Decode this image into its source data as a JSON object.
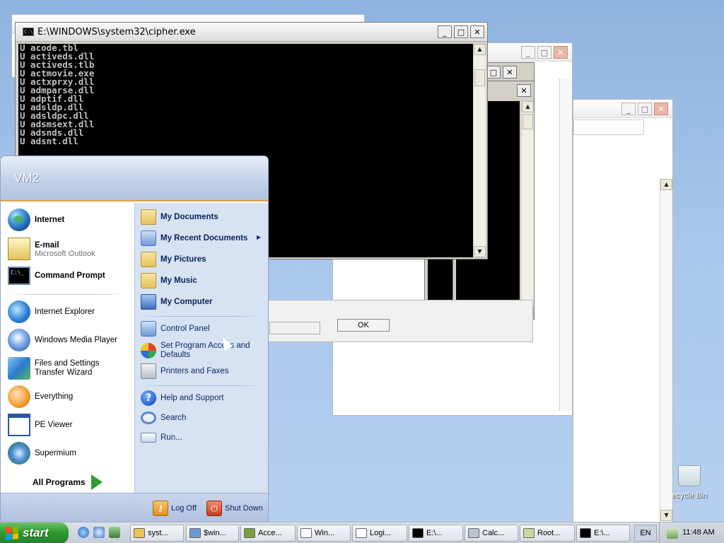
{
  "console": {
    "title": "E:\\WINDOWS\\system32\\cipher.exe",
    "lines": [
      "U acode.tbl",
      "U activeds.dll",
      "U activeds.tlb",
      "U actmovie.exe",
      "U actxprxy.dll",
      "U admparse.dll",
      "U adptif.dll",
      "U adsldp.dll",
      "U adsldpc.dll",
      "U adsmsext.dll",
      "U adsnds.dll",
      "U adsnt.dll"
    ]
  },
  "dialog": {
    "ok_label": "OK"
  },
  "start_menu": {
    "user": "VM2",
    "pinned": [
      {
        "label": "Internet"
      },
      {
        "label": "E-mail",
        "sub": "Microsoft Outlook"
      },
      {
        "label": "Command Prompt"
      }
    ],
    "recent": [
      {
        "label": "Internet Explorer"
      },
      {
        "label": "Windows Media Player"
      },
      {
        "label": "Files and Settings Transfer Wizard"
      },
      {
        "label": "Everything"
      },
      {
        "label": "PE Viewer"
      },
      {
        "label": "Supermium"
      }
    ],
    "all_programs": "All Programs",
    "places": [
      {
        "label": "My Documents"
      },
      {
        "label": "My Recent Documents"
      },
      {
        "label": "My Pictures"
      },
      {
        "label": "My Music"
      },
      {
        "label": "My Computer"
      }
    ],
    "settings": [
      {
        "label": "Control Panel"
      },
      {
        "label": "Set Program Access and Defaults"
      },
      {
        "label": "Printers and Faxes"
      }
    ],
    "tools": [
      {
        "label": "Help and Support"
      },
      {
        "label": "Search"
      },
      {
        "label": "Run..."
      }
    ],
    "log_off": "Log Off",
    "shut_down": "Shut Down"
  },
  "taskbar": {
    "start_label": "start",
    "tasks": [
      {
        "label": "syst...",
        "icon_color": "#e8c45a"
      },
      {
        "label": "$win...",
        "icon_color": "#6d98d8"
      },
      {
        "label": "Acce...",
        "icon_color": "#7a9e3a"
      },
      {
        "label": "Win...",
        "icon_color": "#ffffff"
      },
      {
        "label": "Logi...",
        "icon_color": "#ffffff"
      },
      {
        "label": "E:\\...",
        "icon_color": "#000000"
      },
      {
        "label": "Calc...",
        "icon_color": "#b9c3d3"
      },
      {
        "label": "Root...",
        "icon_color": "#cbd7a2"
      },
      {
        "label": "E:\\...",
        "icon_color": "#000000"
      }
    ],
    "language": "EN",
    "clock": "11:48 AM"
  },
  "desktop": {
    "recycle_bin_label": "ecycle Bin"
  }
}
